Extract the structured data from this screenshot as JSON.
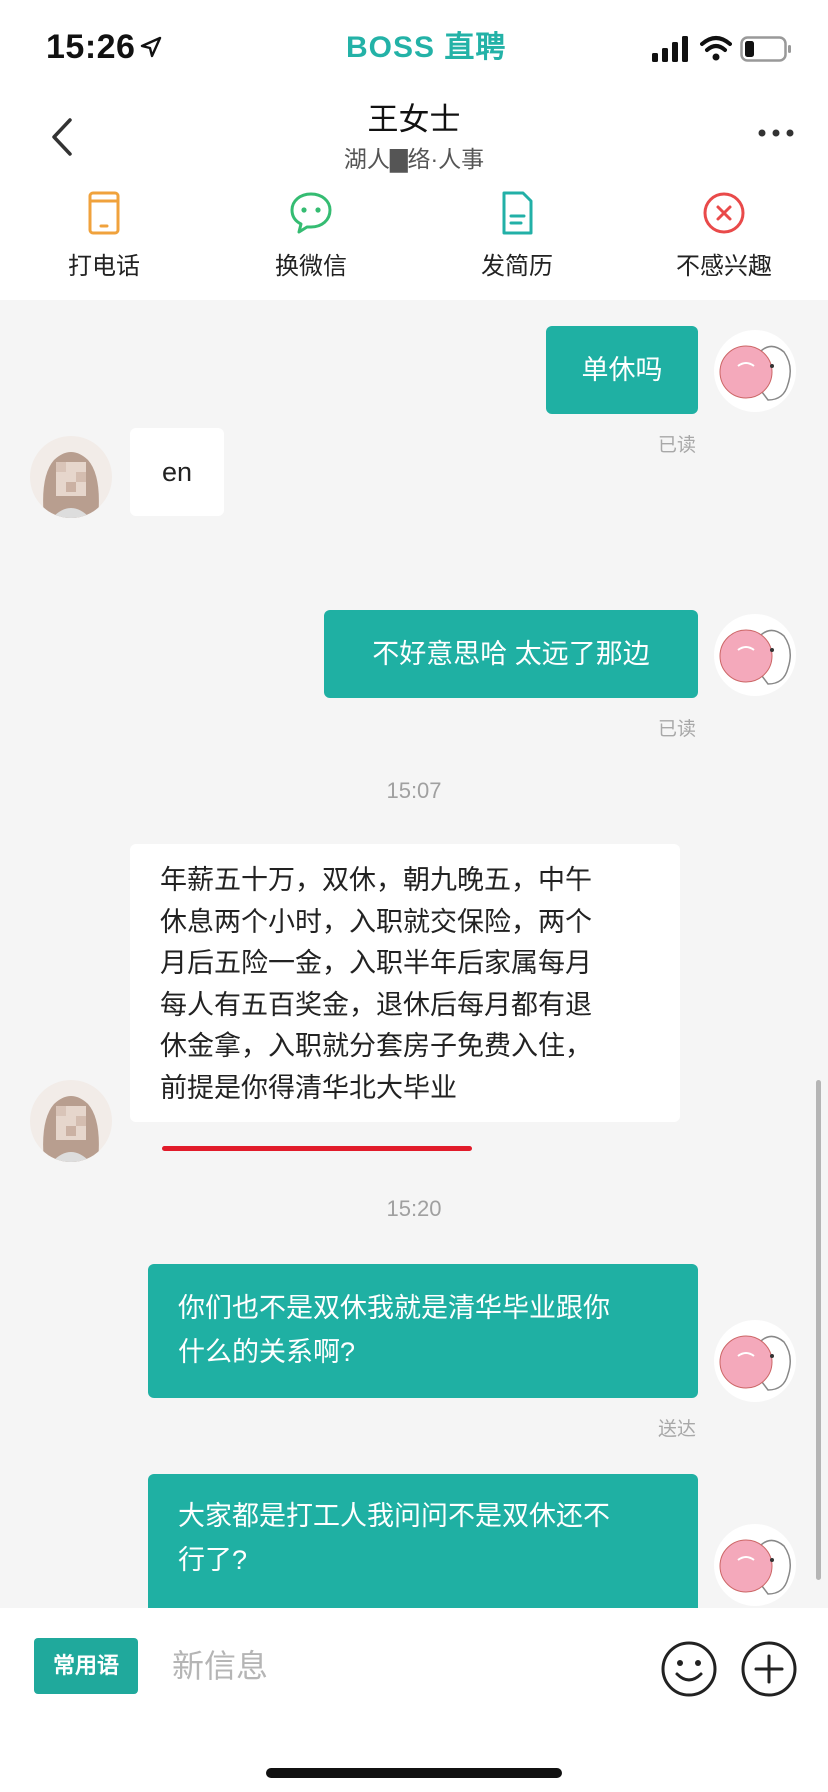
{
  "status_bar": {
    "time": "15:26",
    "carrier": "BOSS 直聘"
  },
  "header": {
    "title": "王女士",
    "subtitle": "湖人▇络·人事",
    "actions": [
      {
        "label": "打电话",
        "icon": "phone-icon",
        "color": "#f0a23c"
      },
      {
        "label": "换微信",
        "icon": "wechat-icon",
        "color": "#35bc72"
      },
      {
        "label": "发简历",
        "icon": "resume-icon",
        "color": "#22b0a7"
      },
      {
        "label": "不感兴趣",
        "icon": "not-interested-icon",
        "color": "#e94a4a"
      }
    ]
  },
  "messages": [
    {
      "side": "mine",
      "text": "单休吗",
      "status": "已读"
    },
    {
      "side": "theirs",
      "text": "en"
    },
    {
      "side": "mine",
      "text": "不好意思哈 太远了那边",
      "status": "已读"
    },
    {
      "time": "15:07"
    },
    {
      "side": "theirs",
      "lines": [
        "年薪五十万，双休，朝九晚五，中午",
        "休息两个小时，入职就交保险，两个",
        "月后五险一金，入职半年后家属每月",
        "每人有五百奖金，退休后每月都有退",
        "休金拿，入职就分套房子免费入住，",
        "前提是你得清华北大毕业"
      ]
    },
    {
      "time": "15:20"
    },
    {
      "side": "mine",
      "lines": [
        "你们也不是双休我就是清华毕业跟你",
        "什么的关系啊?"
      ],
      "status": "送达"
    },
    {
      "side": "mine",
      "lines": [
        "大家都是打工人我问问不是双休还不",
        "行了?"
      ]
    }
  ],
  "input": {
    "phrases_label": "常用语",
    "placeholder": "新信息"
  },
  "colors": {
    "accent": "#1fb0a3",
    "brand": "#23b2a7",
    "underline": "#e11b2a"
  }
}
